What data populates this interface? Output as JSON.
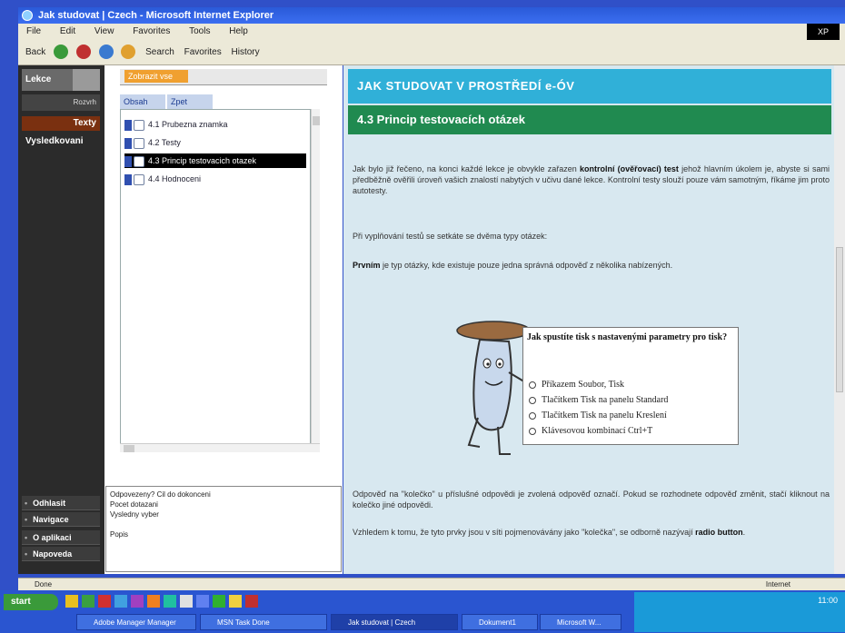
{
  "window": {
    "title": "Jak studovat | Czech - Microsoft Internet Explorer",
    "menu": [
      "File",
      "Edit",
      "View",
      "Favorites",
      "Tools",
      "Help"
    ],
    "toolbar": {
      "back": "Back",
      "search": "Search",
      "favorites": "Favorites",
      "history": "History"
    }
  },
  "left_panel": {
    "logo": "Lekce",
    "subtitle": "Rozvrh",
    "items": [
      "Texty",
      "Vysledkovani"
    ],
    "bottom": [
      "Odhlasit",
      "Navigace",
      "O aplikaci",
      "Napoveda"
    ]
  },
  "tree_panel": {
    "header_tab": "Zobrazit vse",
    "tabs": [
      "Obsah",
      "Zpet"
    ],
    "items": [
      {
        "label": "4.1 Prubezna znamka"
      },
      {
        "label": "4.2 Testy"
      },
      {
        "label": "4.3 Princip testovacich otazek",
        "selected": true
      },
      {
        "label": "4.4 Hodnoceni"
      }
    ],
    "notes": [
      "Odpovezeny? Cil do dokonceni",
      "Pocet dotazani",
      "Vysledny vyber",
      "",
      "Popis"
    ]
  },
  "content": {
    "header": "JAK STUDOVAT V PROSTŘEDÍ e-ÓV",
    "subheader": "4.3 Princip testovacích otázek",
    "paragraphs": [
      {
        "pre": "Jak bylo již řečeno, na konci každé lekce je obvykle zařazen ",
        "bold": "kontrolní (ověřovací) test",
        "post": " jehož hlavním úkolem je, abyste si sami předběžně ověřili úroveň vašich znalostí nabytých v učivu dané lekce. Kontrolní testy slouží pouze vám samotným, říkáme jim proto autotesty."
      },
      {
        "pre": "Při vyplňování testů se setkáte se dvěma typy otázek:",
        "bold": "",
        "post": ""
      },
      {
        "pre": "",
        "bold": "Prvním",
        "post": " je typ otázky, kde existuje pouze jedna správná odpověď z několika nabízených."
      }
    ],
    "after": [
      {
        "pre": "Odpověď na \"kolečko\" u příslušné odpovědi je zvolená odpověď označí. Pokud se rozhodnete odpověď změnit, stačí kliknout na kolečko jiné odpovědi.",
        "bold": "",
        "post": ""
      },
      {
        "pre": "Vzhledem k tomu, že tyto prvky jsou v síti pojmenovávány jako \"kolečka\", se odborně nazývají ",
        "bold": "radio button",
        "post": "."
      }
    ],
    "quiz": {
      "question": "Jak spustíte tisk s nastavenými parametry pro tisk?",
      "options": [
        "Příkazem Soubor, Tisk",
        "Tlačítkem Tisk na panelu Standard",
        "Tlačítkem Tisk na panelu Kreslení",
        "Klávesovou kombinací Ctrl+T"
      ]
    }
  },
  "status": {
    "left": "Done",
    "zone": "Internet"
  },
  "taskbar": {
    "start": "start",
    "buttons": [
      "Adobe Manager Manager",
      "MSN Task Done",
      "Jak studovat | Czech",
      "Dokument1",
      "Microsoft W..."
    ],
    "clock": "11:00"
  },
  "colors": {
    "header": "#30b0d8",
    "subheader": "#208a50",
    "content_bg": "#d8e8f0",
    "taskbar": "#2a55d0"
  }
}
